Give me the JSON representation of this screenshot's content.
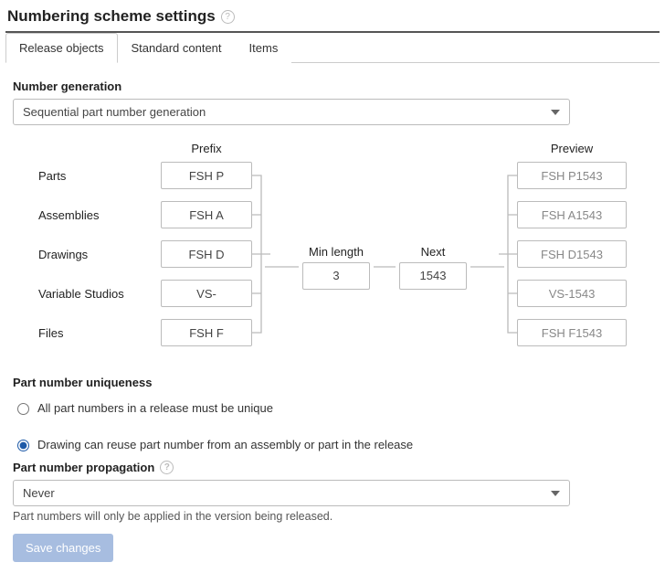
{
  "header": {
    "title": "Numbering scheme settings"
  },
  "tabs": [
    {
      "id": "release",
      "label": "Release objects",
      "active": true
    },
    {
      "id": "standard",
      "label": "Standard content",
      "active": false
    },
    {
      "id": "items",
      "label": "Items",
      "active": false
    }
  ],
  "generation": {
    "section_label": "Number generation",
    "scheme": "Sequential part number generation",
    "columns": {
      "prefix": "Prefix",
      "min_length": "Min length",
      "next": "Next",
      "preview": "Preview"
    },
    "min_length": "3",
    "next": "1543",
    "rows": [
      {
        "label": "Parts",
        "prefix": "FSH P",
        "preview": "FSH P1543"
      },
      {
        "label": "Assemblies",
        "prefix": "FSH A",
        "preview": "FSH A1543"
      },
      {
        "label": "Drawings",
        "prefix": "FSH D",
        "preview": "FSH D1543"
      },
      {
        "label": "Variable Studios",
        "prefix": "VS-",
        "preview": "VS-1543"
      },
      {
        "label": "Files",
        "prefix": "FSH F",
        "preview": "FSH F1543"
      }
    ]
  },
  "uniqueness": {
    "section_label": "Part number uniqueness",
    "options": [
      {
        "label": "All part numbers in a release must be unique",
        "selected": false
      },
      {
        "label": "Drawing can reuse part number from an assembly or part in the release",
        "selected": true
      }
    ]
  },
  "propagation": {
    "section_label": "Part number propagation",
    "value": "Never",
    "hint": "Part numbers will only be applied in the version being released."
  },
  "buttons": {
    "save": "Save changes"
  }
}
